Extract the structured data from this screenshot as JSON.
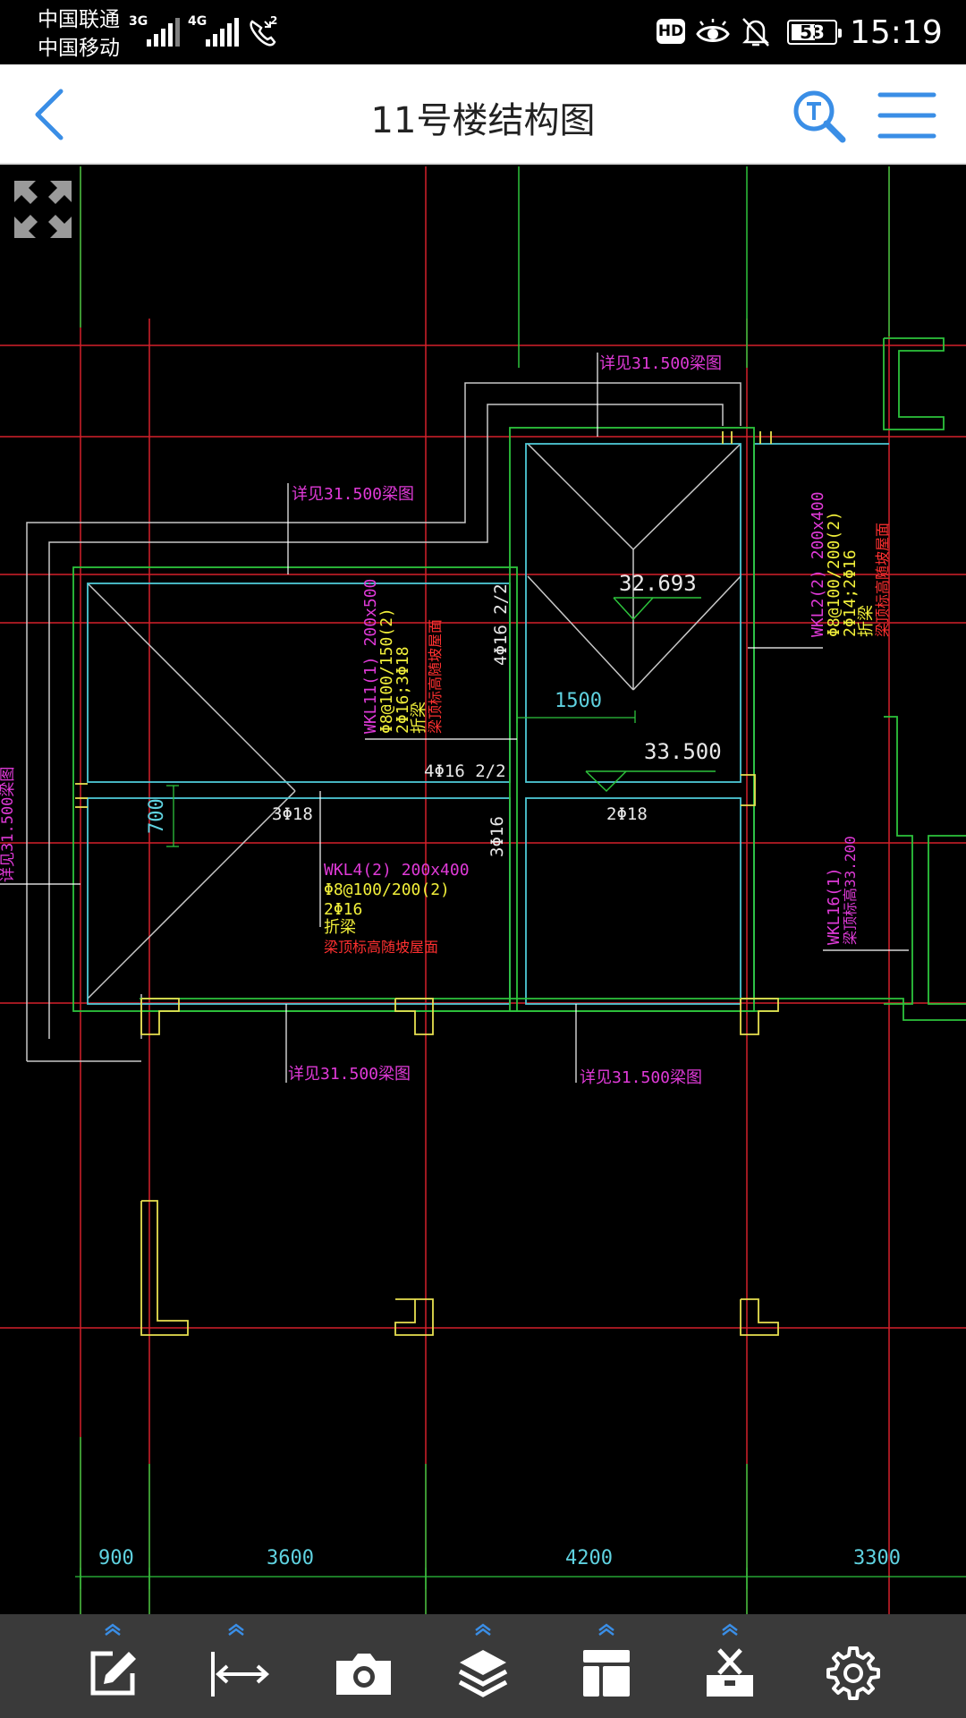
{
  "status_bar": {
    "carrier_1": "中国联通",
    "carrier_2": "中国移动",
    "net_1": "3G",
    "net_2": "4G",
    "call_badge": "2",
    "hd": "HD",
    "battery": "53",
    "time": "15:19"
  },
  "header": {
    "title": "11号楼结构图"
  },
  "drawing": {
    "labels": {
      "ref_top": "详见31.500梁图",
      "ref_mid": "详见31.500梁图",
      "ref_bottom_left": "详见31.500梁图",
      "ref_bottom_right": "详见31.500梁图",
      "ref_left_vertical": "详见31.500梁图",
      "elev_1": "32.693",
      "elev_2": "33.500",
      "dim_1500": "1500",
      "dim_700": "700",
      "rebar_4f16_v": "4Φ16 2/2",
      "rebar_4f16_h": "4Φ16 2/2",
      "rebar_3f18": "3Φ18",
      "rebar_2f18": "2Φ18",
      "rebar_3f16": "3Φ16",
      "wkl11_1": "WKL11(1) 200x500",
      "wkl11_2": "Φ8@100/150(2)",
      "wkl11_3": "2Φ16;3Φ18",
      "wkl11_4": "折梁",
      "wkl11_5": "梁顶标高随坡屋面",
      "wkl2_1": "WKL2(2) 200x400",
      "wkl2_2": "Φ8@100/200(2)",
      "wkl2_3": "2Φ14;2Φ16",
      "wkl2_4": "折梁",
      "wkl2_5": "梁顶标高随坡屋面",
      "wkl4_1": "WKL4(2) 200x400",
      "wkl4_2": "Φ8@100/200(2)",
      "wkl4_3": "2Φ16",
      "wkl4_4": "折梁",
      "wkl4_5": "梁顶标高随坡屋面",
      "wkl16_1": "WKL16(1)",
      "wkl16_2": "梁顶标高33.200",
      "dims_bottom": [
        "900",
        "3600",
        "4200",
        "3300"
      ]
    }
  },
  "toolbar": {
    "items": [
      "edit-icon",
      "measure-icon",
      "camera-icon",
      "layers-icon",
      "layout-icon",
      "toolbox-icon",
      "settings-icon"
    ]
  },
  "colors": {
    "accent": "#3a8ee6",
    "axis_red": "#d4212a",
    "wall_green": "#2dc33c",
    "beam_cyan": "#4ec9d6",
    "label_magenta": "#e03ad8",
    "label_yellow": "#f2f03a",
    "label_red": "#ff3030",
    "dim_cyan": "#5fd2e0",
    "outline_gray": "#c8c8c8"
  }
}
